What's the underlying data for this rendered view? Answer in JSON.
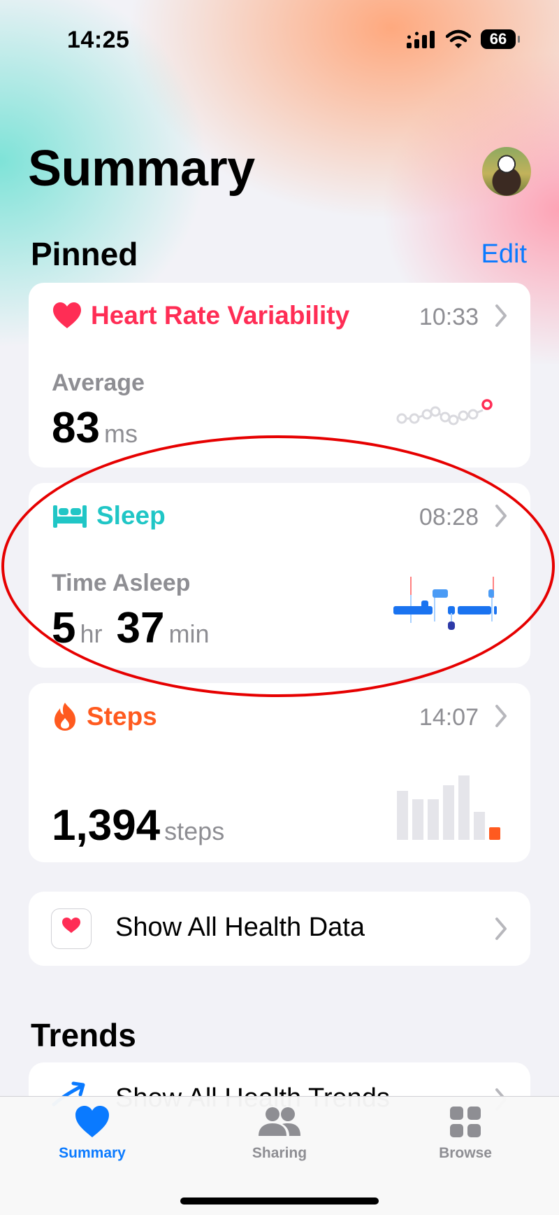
{
  "status_bar": {
    "time": "14:25",
    "battery": "66"
  },
  "header": {
    "title": "Summary"
  },
  "pinned": {
    "title": "Pinned",
    "edit_label": "Edit",
    "cards": [
      {
        "title": "Heart Rate Variability",
        "time": "10:33",
        "label": "Average",
        "value": "83",
        "unit": "ms",
        "color": "#ff2d55",
        "icon": "heart-icon"
      },
      {
        "title": "Sleep",
        "time": "08:28",
        "label": "Time Asleep",
        "value_hr": "5",
        "unit_hr": "hr",
        "value_min": "37",
        "unit_min": "min",
        "color": "#20c6c6",
        "icon": "bed-icon"
      },
      {
        "title": "Steps",
        "time": "14:07",
        "value": "1,394",
        "unit": "steps",
        "color": "#ff5a1f",
        "icon": "flame-icon"
      }
    ]
  },
  "show_all": {
    "label": "Show All Health Data"
  },
  "trends": {
    "title": "Trends",
    "item_label": "Show All Health Trends"
  },
  "tabs": [
    {
      "label": "Summary",
      "icon": "heart-icon",
      "active": true
    },
    {
      "label": "Sharing",
      "icon": "people-icon",
      "active": false
    },
    {
      "label": "Browse",
      "icon": "grid-icon",
      "active": false
    }
  ],
  "colors": {
    "accent": "#0a7aff",
    "inactive": "#8e8e93",
    "annotation": "#e60000"
  }
}
